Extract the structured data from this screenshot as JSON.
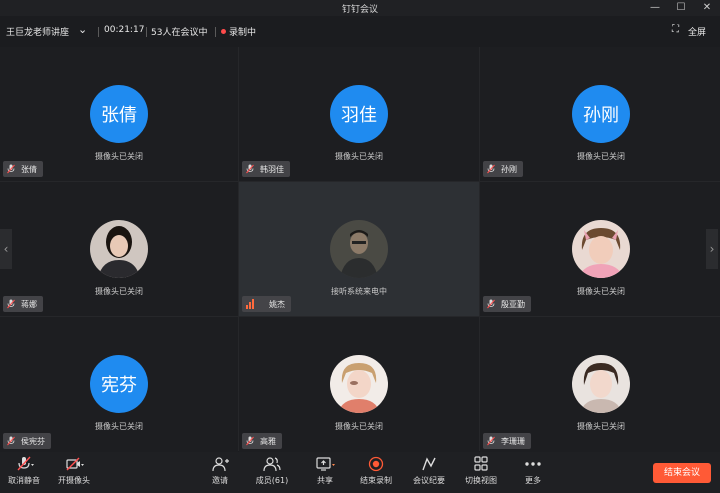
{
  "window": {
    "title": "钉钉会议",
    "controls": [
      "—",
      "☐",
      "✕"
    ]
  },
  "infobar": {
    "meeting_name": "王巨龙老师讲座",
    "duration": "00:21:17",
    "participants_in_meeting": "53人在会议中",
    "recording": "录制中",
    "fullscreen": "全屏"
  },
  "tiles": [
    {
      "name": "张倩",
      "avatar_text": "张倩",
      "status": "摄像头已关闭"
    },
    {
      "name": "韩羽佳",
      "avatar_text": "羽佳",
      "status": "摄像头已关闭"
    },
    {
      "name": "孙刚",
      "avatar_text": "孙刚",
      "status": "摄像头已关闭"
    },
    {
      "name": "蒋娜",
      "status": "摄像头已关闭"
    },
    {
      "name": "姚杰",
      "status": "接听系统来电中"
    },
    {
      "name": "殷亚勤",
      "status": "摄像头已关闭"
    },
    {
      "name": "侯宪芬",
      "avatar_text": "宪芬",
      "status": "摄像头已关闭"
    },
    {
      "name": "高雅",
      "status": "摄像头已关闭"
    },
    {
      "name": "李珊珊",
      "status": "摄像头已关闭"
    }
  ],
  "toolbar": {
    "mute": "取消静音",
    "camera": "开摄像头",
    "invite": "邀请",
    "members": "成员(61)",
    "share": "共享",
    "stop_recording": "结束录制",
    "minutes": "会议纪要",
    "switch_view": "切换视图",
    "more": "更多",
    "end_meeting": "结束会议"
  },
  "colors": {
    "avatar_blue": "#1f8bf0",
    "end_button": "#ff5a36",
    "recording_dot": "#ff4b4b"
  }
}
